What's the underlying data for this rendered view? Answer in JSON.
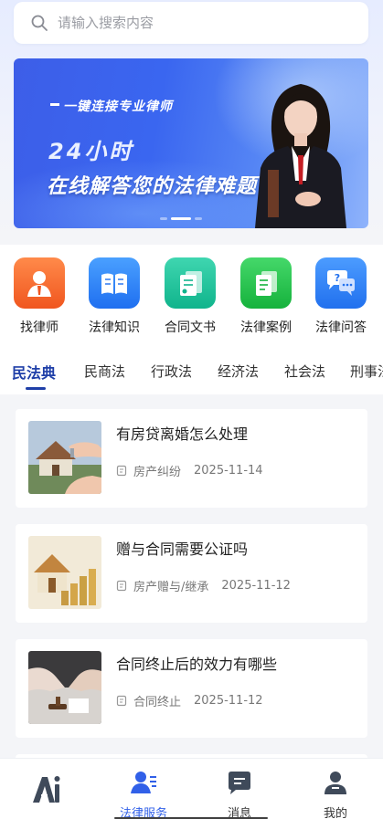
{
  "search": {
    "placeholder": "请输入搜索内容"
  },
  "banner": {
    "tagline": "一键连接专业律师",
    "title1": "24小时",
    "title2": "在线解答您的法律难题"
  },
  "categories": [
    {
      "label": "找律师",
      "icon": "lawyer-icon",
      "color": "#f2682a"
    },
    {
      "label": "法律知识",
      "icon": "book-icon",
      "color": "#2b7ff3"
    },
    {
      "label": "合同文书",
      "icon": "contract-doc-icon",
      "color": "#19c29a"
    },
    {
      "label": "法律案例",
      "icon": "case-doc-icon",
      "color": "#22c04a"
    },
    {
      "label": "法律问答",
      "icon": "qa-bubble-icon",
      "color": "#2f7ff2"
    }
  ],
  "tabs": [
    "民法典",
    "民商法",
    "行政法",
    "经济法",
    "社会法",
    "刑事法"
  ],
  "active_tab": "民法典",
  "articles": [
    {
      "title": "有房贷离婚怎么处理",
      "tag": "房产纠纷",
      "date": "2025-11-14"
    },
    {
      "title": "赠与合同需要公证吗",
      "tag": "房产赠与/继承",
      "date": "2025-11-12"
    },
    {
      "title": "合同终止后的效力有哪些",
      "tag": "合同终止",
      "date": "2025-11-12"
    }
  ],
  "nav": [
    {
      "label": "",
      "icon": "ai-logo-icon"
    },
    {
      "label": "法律服务",
      "icon": "legal-service-icon"
    },
    {
      "label": "消息",
      "icon": "message-icon"
    },
    {
      "label": "我的",
      "icon": "profile-icon"
    }
  ],
  "colors": {
    "accent": "#3160e8",
    "tab_active": "#1f3fa8"
  }
}
